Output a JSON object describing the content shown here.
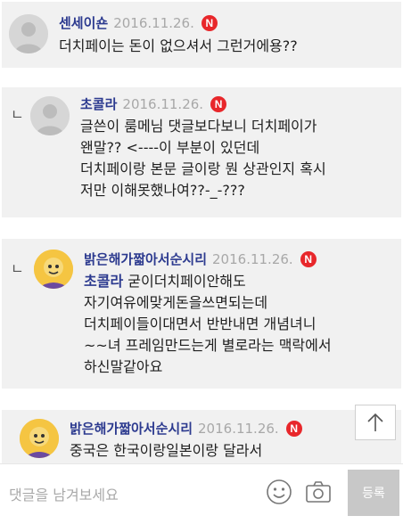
{
  "comments": [
    {
      "author": "센세이숀",
      "date": "2016.11.26.",
      "badge": "N",
      "text": "더치페이는 돈이 없으셔서 그런거에용??"
    },
    {
      "reply_mark": "ㄴ",
      "author": "초콜라",
      "date": "2016.11.26.",
      "badge": "N",
      "text": "글쓴이 룸메님 댓글보다보니 더치페이가\n왠말?? <----이 부분이 있던데\n더치페이랑 본문 글이랑 뭔 상관인지 혹시\n저만 이해못했나여??-_-???"
    },
    {
      "reply_mark": "ㄴ",
      "author": "밝은해가짧아서순시리",
      "date": "2016.11.26.",
      "badge": "N",
      "mention": "초콜라",
      "text_first": " 굳이더치페이안해도",
      "text": "자기여유에맞게돈을쓰면되는데\n더치페이들이대면서 반반내면 개념녀니\n~~녀 프레임만드는게 별로라는 맥락에서\n하신말같아요"
    },
    {
      "author": "밝은해가짧아서순시리",
      "date": "2016.11.26.",
      "badge": "N",
      "text": "중국은 한국이랑일본이랑 달라서"
    }
  ],
  "scroll_top_icon": "arrow-up-icon",
  "comment_box": {
    "placeholder": "댓글을 남겨보세요",
    "emoji_icon": "smiley-icon",
    "camera_icon": "camera-icon",
    "submit_label": "등록"
  },
  "colors": {
    "author": "#2c3a8f",
    "date": "#a8a8a8",
    "new_badge": "#e8272b",
    "card_bg": "#f1f1f1",
    "submit_bg": "#c8c8c8"
  }
}
